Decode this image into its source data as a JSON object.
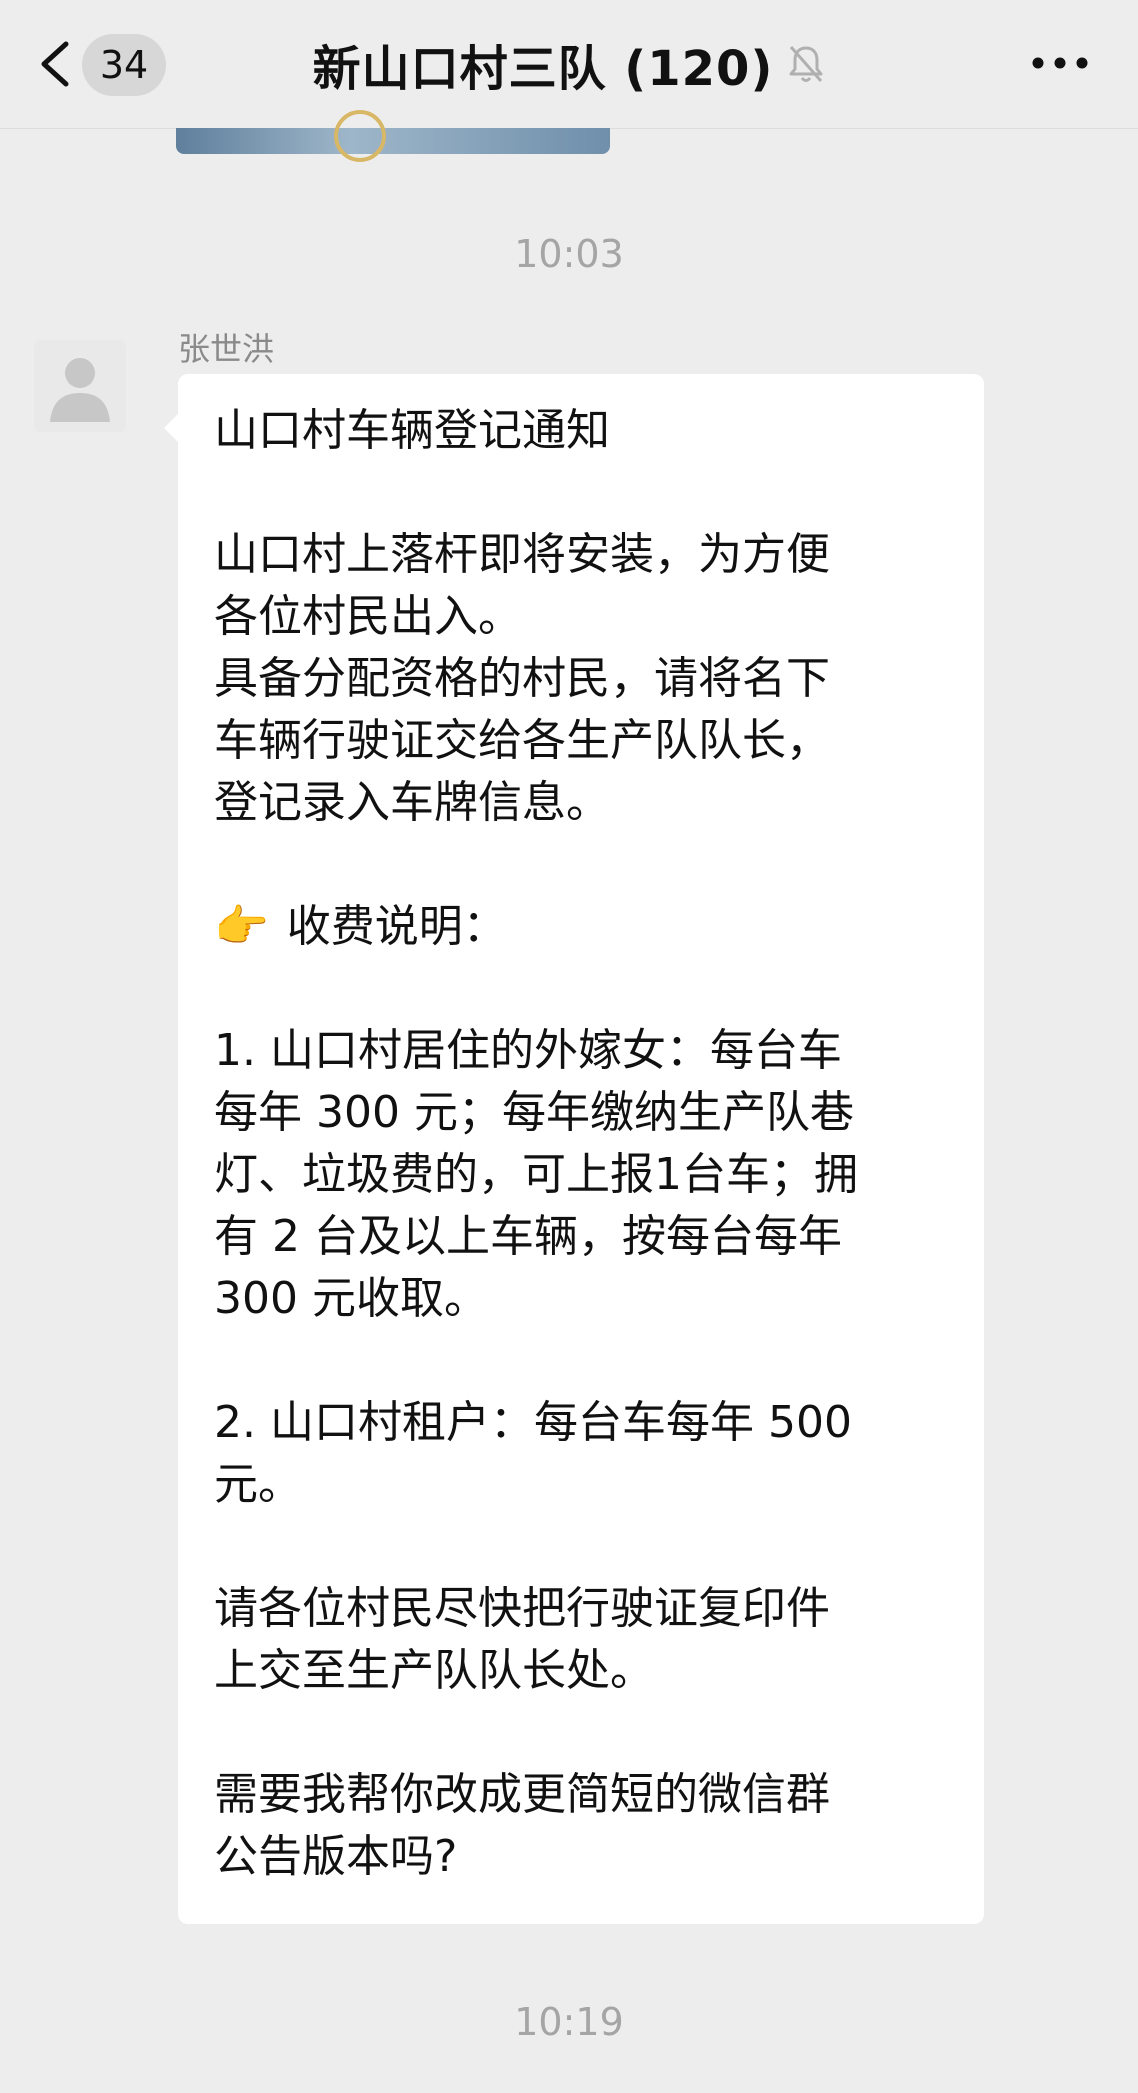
{
  "header": {
    "back_count": "34",
    "title": "新山口村三队 (120)"
  },
  "timestamps": [
    "10:03",
    "10:19"
  ],
  "message": {
    "sender": "张世洪",
    "heading": "山口村车辆登记通知",
    "para1_line1": "山口村上落杆即将安装，为方便",
    "para1_line2": "各位村民出入。",
    "para1_line3": "具备分配资格的村民，请将名下",
    "para1_line4": "车辆行驶证交给各生产队队长，",
    "para1_line5": "登记录入车牌信息。",
    "fee_emoji": "👉",
    "fee_heading": "收费说明：",
    "item1_line1": "1. 山口村居住的外嫁女：每台车",
    "item1_line2": "每年 300 元；每年缴纳生产队巷",
    "item1_line3": "灯、垃圾费的，可上报1台车；拥",
    "item1_line4": "有 2 台及以上车辆，按每台每年",
    "item1_line5": "300 元收取。",
    "item2_line1": "2. 山口村租户：每台车每年 500",
    "item2_line2": "元。",
    "closing_line1": "请各位村民尽快把行驶证复印件",
    "closing_line2": "上交至生产队队长处。",
    "ai_line1": "需要我帮你改成更简短的微信群",
    "ai_line2": "公告版本吗?"
  },
  "icons": {
    "back": "chevron-left-icon",
    "mute": "bell-off-icon",
    "more": "more-dots-icon",
    "avatar": "default-avatar-icon"
  },
  "colors": {
    "background": "#ededed",
    "bubble": "#ffffff",
    "timestamp": "#a5a5a5",
    "sender": "#8a8a8a"
  }
}
